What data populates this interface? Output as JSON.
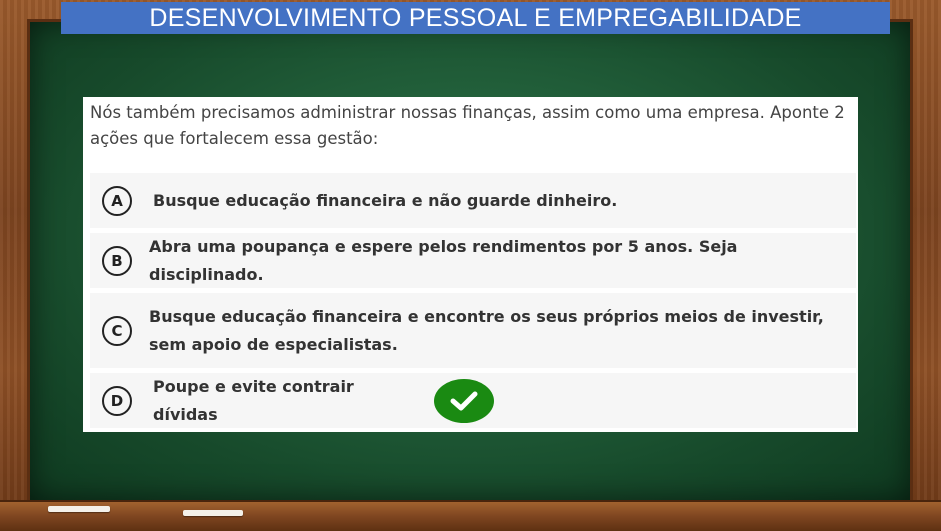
{
  "title": "DESENVOLVIMENTO PESSOAL E EMPREGABILIDADE",
  "question": "Nós também precisamos administrar nossas finanças, assim como uma empresa. Aponte 2 ações que fortalecem essa gestão:",
  "options": [
    {
      "letter": "A",
      "text": "Busque educação financeira e não guarde dinheiro."
    },
    {
      "letter": "B",
      "text": "Abra uma poupança e espere pelos rendimentos por 5 anos. Seja disciplinado."
    },
    {
      "letter": "C",
      "text": "Busque educação financeira e encontre os seus próprios meios de investir, sem apoio de especialistas."
    },
    {
      "letter": "D",
      "text": "Poupe e evite contrair dívidas"
    }
  ],
  "correct_marker": {
    "icon": "checkmark-icon",
    "color": "#1a8a12"
  },
  "colors": {
    "title_bar": "#4472c4",
    "board": "#23623c",
    "frame": "#7c4420"
  }
}
